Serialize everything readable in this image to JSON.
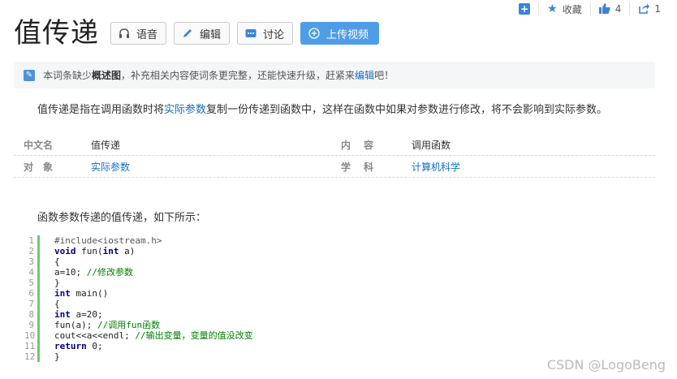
{
  "topbar": {
    "add_icon": "plus-square-icon",
    "favorite_label": "收藏",
    "like_count": "4",
    "share_count": "1"
  },
  "header": {
    "title": "值传递",
    "buttons": {
      "voice": "语音",
      "edit": "编辑",
      "discuss": "讨论",
      "upload": "上传视频"
    }
  },
  "notice": {
    "text_before": "本词条缺少",
    "bold": "概述图",
    "text_middle": "，补充相关内容使词条更完整，还能快速升级，赶紧来",
    "link": "编辑",
    "text_after": "吧！"
  },
  "intro": {
    "before": "值传递是指在调用函数时将",
    "link": "实际参数",
    "after": "复制一份传递到函数中，这样在函数中如果对参数进行修改，将不会影响到实际参数。"
  },
  "infobox": {
    "rows": [
      {
        "label1": "中文名",
        "value1": "值传递",
        "label2": "内　容",
        "value2": "调用函数"
      },
      {
        "label1": "对　象",
        "value1": "实际参数",
        "label2": "学　科",
        "value2": "计算机科学"
      }
    ]
  },
  "section_text": "函数参数传递的值传递，如下所示：",
  "code": {
    "lines": [
      {
        "n": "1",
        "t": "#include<iostream.h>"
      },
      {
        "n": "2",
        "t": "void fun(int a)"
      },
      {
        "n": "3",
        "t": "{"
      },
      {
        "n": "4",
        "t": "a=10; //修改参数"
      },
      {
        "n": "5",
        "t": "}"
      },
      {
        "n": "6",
        "t": "int main()"
      },
      {
        "n": "7",
        "t": "{"
      },
      {
        "n": "8",
        "t": "int a=20;"
      },
      {
        "n": "9",
        "t": "fun(a); //调用fun函数"
      },
      {
        "n": "10",
        "t": "cout<<a<<endl; //输出变量，变量的值没改变"
      },
      {
        "n": "11",
        "t": "return 0;"
      },
      {
        "n": "12",
        "t": "}"
      }
    ]
  },
  "watermark": "CSDN @LogoBeng",
  "colors": {
    "accent": "#136ec2",
    "upload_button": "#4f9de6",
    "code_gutter": "#6ccb6c"
  }
}
